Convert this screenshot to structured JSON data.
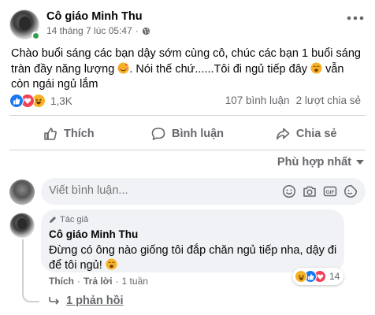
{
  "post": {
    "author": "Cô giáo Minh Thu",
    "timestamp": "14 tháng 7 lúc 05:47",
    "separator": "·",
    "privacy_icon": "globe-icon",
    "text_line1": "Chào buổi sáng các bạn dậy sớm cùng cô, chúc các bạn 1 buổi sáng",
    "text_line2": "tràn đầy năng lượng",
    "text_line2b": ". Nói thế chứ......Tôi đi ngủ tiếp đây",
    "text_line3": "vẫn",
    "text_line4": "còn ngái ngủ lắm"
  },
  "stats": {
    "reaction_count": "1,3K",
    "comments": "107 bình luận",
    "shares": "2 lượt chia sẻ"
  },
  "actions": {
    "like": "Thích",
    "comment": "Bình luận",
    "share": "Chia sẻ"
  },
  "sort": {
    "label": "Phù hợp nhất"
  },
  "composer": {
    "placeholder": "Viết bình luận..."
  },
  "comment": {
    "badge": "Tác giả",
    "author": "Cô giáo Minh Thu",
    "text_line1": "Đừng có ông nào giống tôi đắp chăn ngủ tiếp nha, dậy đi",
    "text_line2": "để tôi ngủ!",
    "like": "Thích",
    "reply": "Trả lời",
    "time": "1 tuần",
    "separator": "·",
    "reaction_count": "14"
  },
  "replies": {
    "label": "1 phản hồi"
  },
  "colors": {
    "like_blue": "#1877f2",
    "love_red": "#f33e58",
    "haha_yellow": "#f7b125",
    "online_green": "#31a24c"
  }
}
